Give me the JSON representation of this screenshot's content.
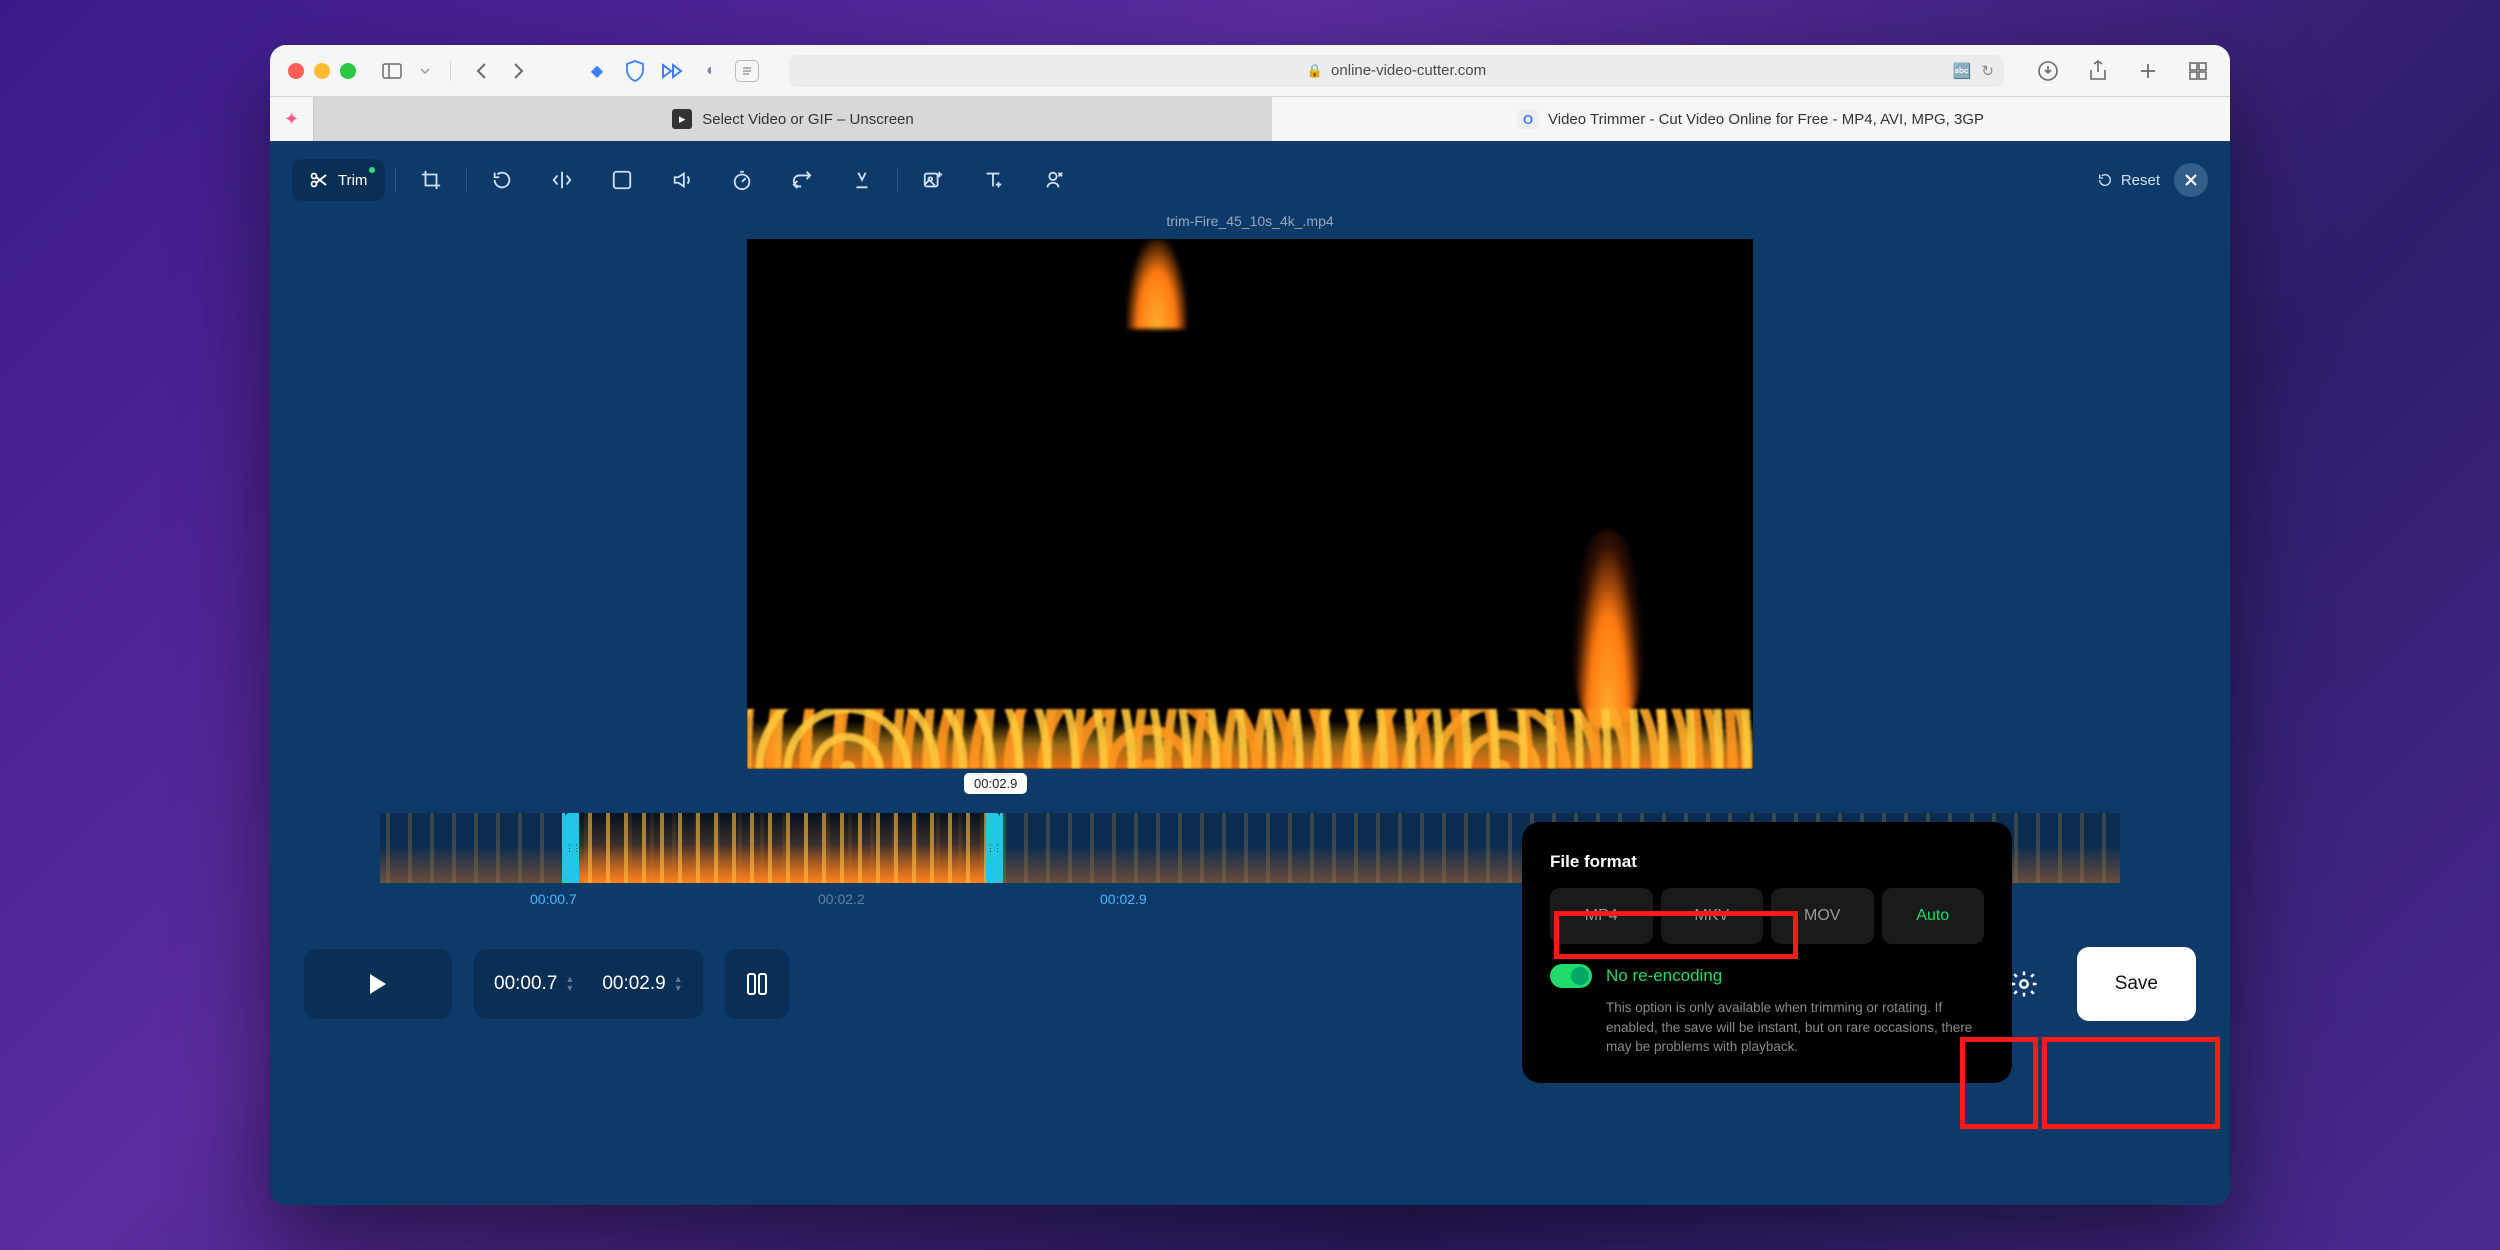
{
  "browser": {
    "url": "online-video-cutter.com",
    "tabs": [
      {
        "label": "Select Video or GIF – Unscreen",
        "active": false
      },
      {
        "label": "Video Trimmer - Cut Video Online for Free - MP4, AVI, MPG, 3GP",
        "active": true
      }
    ]
  },
  "toolbar": {
    "trim_label": "Trim",
    "reset_label": "Reset"
  },
  "filename": "trim-Fire_45_10s_4k_.mp4",
  "timeline": {
    "playhead": "00:02.9",
    "start_label": "00:00.7",
    "mid_label": "00:02.2",
    "end_label": "00:02.9"
  },
  "times": {
    "in": "00:00.7",
    "out": "00:02.9"
  },
  "popover": {
    "title": "File format",
    "formats": [
      "MP4",
      "MKV",
      "MOV",
      "Auto"
    ],
    "active_format": "Auto",
    "toggle_label": "No re-encoding",
    "description": "This option is only available when trimming or rotating. If enabled, the save will be instant, but on rare occasions, there may be problems with playback."
  },
  "actions": {
    "save_label": "Save"
  }
}
